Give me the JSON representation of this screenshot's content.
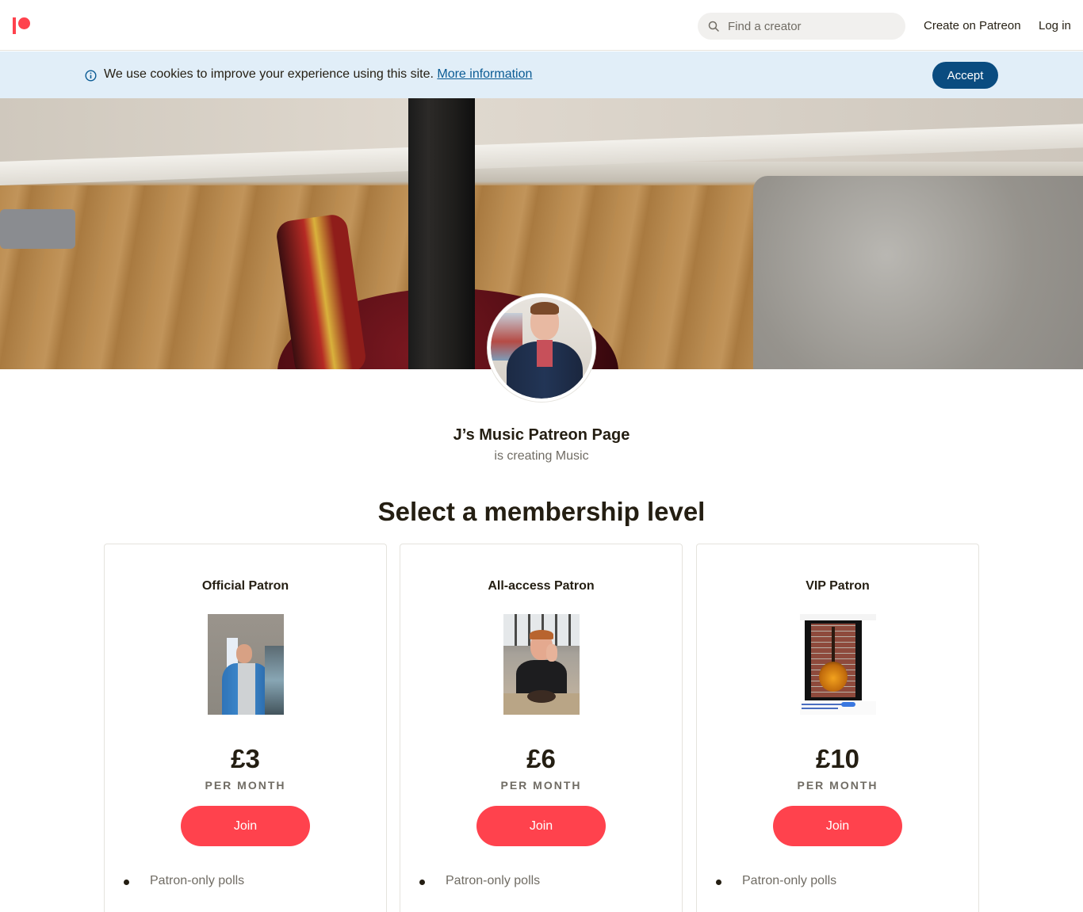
{
  "header": {
    "search_placeholder": "Find a creator",
    "create_label": "Create on Patreon",
    "login_label": "Log in",
    "brand_color": "#ff424d"
  },
  "cookie_banner": {
    "message": "We use cookies to improve your experience using this site.",
    "link_label": "More information",
    "accept_label": "Accept"
  },
  "creator": {
    "name": "J’s Music Patreon Page",
    "subtitle": "is creating Music"
  },
  "membership": {
    "title": "Select a membership level",
    "tiers": [
      {
        "name": "Official Patron",
        "price": "£3",
        "period": "PER MONTH",
        "join_label": "Join",
        "benefit": "Patron-only polls"
      },
      {
        "name": "All-access Patron",
        "price": "£6",
        "period": "PER MONTH",
        "join_label": "Join",
        "benefit": "Patron-only polls"
      },
      {
        "name": "VIP Patron",
        "price": "£10",
        "period": "PER MONTH",
        "join_label": "Join",
        "benefit": "Patron-only polls"
      }
    ]
  },
  "icons": {
    "search": "search-icon",
    "info": "info-icon",
    "logo": "patreon-logo"
  }
}
